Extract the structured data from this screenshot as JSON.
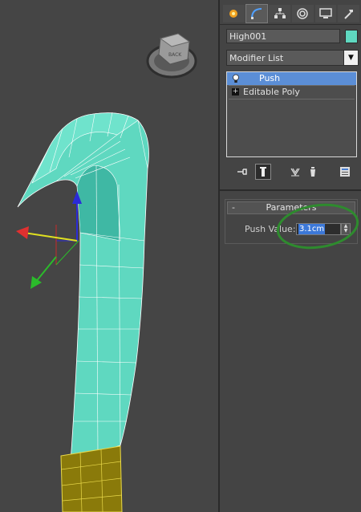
{
  "viewport": {
    "viewcube_label": "BACK",
    "mesh_color": "#5fd8c0",
    "handle_color": "#8a7a0a"
  },
  "panel": {
    "tabs": [
      {
        "icon": "create-icon"
      },
      {
        "icon": "modify-icon",
        "active": true
      },
      {
        "icon": "hierarchy-icon"
      },
      {
        "icon": "motion-icon"
      },
      {
        "icon": "display-icon"
      },
      {
        "icon": "utilities-icon"
      }
    ],
    "object_name": "High001",
    "object_color": "#5fd8c0",
    "modifier_list_label": "Modifier List",
    "stack": [
      {
        "label": "Push",
        "selected": true,
        "icon": "lightbulb-icon"
      },
      {
        "label": "Editable Poly",
        "selected": false,
        "icon": "expand-plus-icon"
      }
    ],
    "stack_buttons": [
      {
        "icon": "pin-stack-icon"
      },
      {
        "icon": "show-end-result-icon",
        "active": true
      },
      {
        "icon": "make-unique-icon"
      },
      {
        "icon": "remove-modifier-icon"
      },
      {
        "icon": "configure-modifier-sets-icon"
      }
    ],
    "rollout": {
      "toggle": "-",
      "title": "Parameters",
      "push_label": "Push Value:",
      "push_value": "3.1cm"
    },
    "annotation_color": "#2e8b2e"
  }
}
